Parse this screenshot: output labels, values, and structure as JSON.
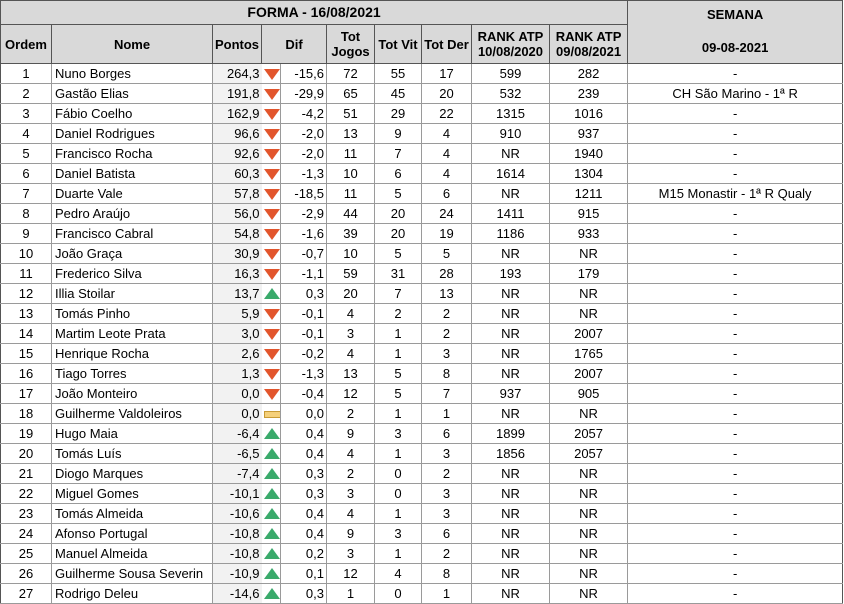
{
  "header": {
    "forma_title": "FORMA - 16/08/2021",
    "col_ordem": "Ordem",
    "col_nome": "Nome",
    "col_pontos": "Pontos",
    "col_dif": "Dif",
    "col_tot_jogos_1": "Tot",
    "col_tot_jogos_2": "Jogos",
    "col_tot_vit": "Tot Vit",
    "col_tot_der": "Tot Der",
    "rank_2020_1": "RANK ATP",
    "rank_2020_2": "10/08/2020",
    "rank_2021_1": "RANK ATP",
    "rank_2021_2": "09/08/2021",
    "semana_1": "SEMANA",
    "semana_2": "09-08-2021"
  },
  "colors": {
    "down": "#e2552c",
    "up": "#3aaa6b",
    "flat": "#f5d07a",
    "header_bg": "#d9d9d9"
  },
  "rows": [
    {
      "ordem": "1",
      "nome": "Nuno Borges",
      "pontos": "264,3",
      "trend": "down",
      "dif": "-15,6",
      "jogos": "72",
      "vit": "55",
      "der": "17",
      "r2020": "599",
      "r2021": "282",
      "semana": "-"
    },
    {
      "ordem": "2",
      "nome": "Gastão Elias",
      "pontos": "191,8",
      "trend": "down",
      "dif": "-29,9",
      "jogos": "65",
      "vit": "45",
      "der": "20",
      "r2020": "532",
      "r2021": "239",
      "semana": "CH São Marino - 1ª R"
    },
    {
      "ordem": "3",
      "nome": "Fábio Coelho",
      "pontos": "162,9",
      "trend": "down",
      "dif": "-4,2",
      "jogos": "51",
      "vit": "29",
      "der": "22",
      "r2020": "1315",
      "r2021": "1016",
      "semana": "-"
    },
    {
      "ordem": "4",
      "nome": "Daniel Rodrigues",
      "pontos": "96,6",
      "trend": "down",
      "dif": "-2,0",
      "jogos": "13",
      "vit": "9",
      "der": "4",
      "r2020": "910",
      "r2021": "937",
      "semana": "-"
    },
    {
      "ordem": "5",
      "nome": "Francisco Rocha",
      "pontos": "92,6",
      "trend": "down",
      "dif": "-2,0",
      "jogos": "11",
      "vit": "7",
      "der": "4",
      "r2020": "NR",
      "r2021": "1940",
      "semana": "-"
    },
    {
      "ordem": "6",
      "nome": "Daniel Batista",
      "pontos": "60,3",
      "trend": "down",
      "dif": "-1,3",
      "jogos": "10",
      "vit": "6",
      "der": "4",
      "r2020": "1614",
      "r2021": "1304",
      "semana": "-"
    },
    {
      "ordem": "7",
      "nome": "Duarte Vale",
      "pontos": "57,8",
      "trend": "down",
      "dif": "-18,5",
      "jogos": "11",
      "vit": "5",
      "der": "6",
      "r2020": "NR",
      "r2021": "1211",
      "semana": "M15 Monastir - 1ª R Qualy"
    },
    {
      "ordem": "8",
      "nome": "Pedro Araújo",
      "pontos": "56,0",
      "trend": "down",
      "dif": "-2,9",
      "jogos": "44",
      "vit": "20",
      "der": "24",
      "r2020": "1411",
      "r2021": "915",
      "semana": "-"
    },
    {
      "ordem": "9",
      "nome": "Francisco Cabral",
      "pontos": "54,8",
      "trend": "down",
      "dif": "-1,6",
      "jogos": "39",
      "vit": "20",
      "der": "19",
      "r2020": "1186",
      "r2021": "933",
      "semana": "-"
    },
    {
      "ordem": "10",
      "nome": "João Graça",
      "pontos": "30,9",
      "trend": "down",
      "dif": "-0,7",
      "jogos": "10",
      "vit": "5",
      "der": "5",
      "r2020": "NR",
      "r2021": "NR",
      "semana": "-"
    },
    {
      "ordem": "11",
      "nome": "Frederico Silva",
      "pontos": "16,3",
      "trend": "down",
      "dif": "-1,1",
      "jogos": "59",
      "vit": "31",
      "der": "28",
      "r2020": "193",
      "r2021": "179",
      "semana": "-"
    },
    {
      "ordem": "12",
      "nome": "Illia Stoilar",
      "pontos": "13,7",
      "trend": "up",
      "dif": "0,3",
      "jogos": "20",
      "vit": "7",
      "der": "13",
      "r2020": "NR",
      "r2021": "NR",
      "semana": "-"
    },
    {
      "ordem": "13",
      "nome": "Tomás Pinho",
      "pontos": "5,9",
      "trend": "down",
      "dif": "-0,1",
      "jogos": "4",
      "vit": "2",
      "der": "2",
      "r2020": "NR",
      "r2021": "NR",
      "semana": "-"
    },
    {
      "ordem": "14",
      "nome": "Martim Leote Prata",
      "pontos": "3,0",
      "trend": "down",
      "dif": "-0,1",
      "jogos": "3",
      "vit": "1",
      "der": "2",
      "r2020": "NR",
      "r2021": "2007",
      "semana": "-"
    },
    {
      "ordem": "15",
      "nome": "Henrique Rocha",
      "pontos": "2,6",
      "trend": "down",
      "dif": "-0,2",
      "jogos": "4",
      "vit": "1",
      "der": "3",
      "r2020": "NR",
      "r2021": "1765",
      "semana": "-"
    },
    {
      "ordem": "16",
      "nome": "Tiago Torres",
      "pontos": "1,3",
      "trend": "down",
      "dif": "-1,3",
      "jogos": "13",
      "vit": "5",
      "der": "8",
      "r2020": "NR",
      "r2021": "2007",
      "semana": "-"
    },
    {
      "ordem": "17",
      "nome": "João Monteiro",
      "pontos": "0,0",
      "trend": "down",
      "dif": "-0,4",
      "jogos": "12",
      "vit": "5",
      "der": "7",
      "r2020": "937",
      "r2021": "905",
      "semana": "-"
    },
    {
      "ordem": "18",
      "nome": "Guilherme Valdoleiros",
      "pontos": "0,0",
      "trend": "flat",
      "dif": "0,0",
      "jogos": "2",
      "vit": "1",
      "der": "1",
      "r2020": "NR",
      "r2021": "NR",
      "semana": "-"
    },
    {
      "ordem": "19",
      "nome": "Hugo Maia",
      "pontos": "-6,4",
      "trend": "up",
      "dif": "0,4",
      "jogos": "9",
      "vit": "3",
      "der": "6",
      "r2020": "1899",
      "r2021": "2057",
      "semana": "-"
    },
    {
      "ordem": "20",
      "nome": "Tomás Luís",
      "pontos": "-6,5",
      "trend": "up",
      "dif": "0,4",
      "jogos": "4",
      "vit": "1",
      "der": "3",
      "r2020": "1856",
      "r2021": "2057",
      "semana": "-"
    },
    {
      "ordem": "21",
      "nome": "Diogo Marques",
      "pontos": "-7,4",
      "trend": "up",
      "dif": "0,3",
      "jogos": "2",
      "vit": "0",
      "der": "2",
      "r2020": "NR",
      "r2021": "NR",
      "semana": "-"
    },
    {
      "ordem": "22",
      "nome": "Miguel Gomes",
      "pontos": "-10,1",
      "trend": "up",
      "dif": "0,3",
      "jogos": "3",
      "vit": "0",
      "der": "3",
      "r2020": "NR",
      "r2021": "NR",
      "semana": "-"
    },
    {
      "ordem": "23",
      "nome": "Tomás Almeida",
      "pontos": "-10,6",
      "trend": "up",
      "dif": "0,4",
      "jogos": "4",
      "vit": "1",
      "der": "3",
      "r2020": "NR",
      "r2021": "NR",
      "semana": "-"
    },
    {
      "ordem": "24",
      "nome": "Afonso Portugal",
      "pontos": "-10,8",
      "trend": "up",
      "dif": "0,4",
      "jogos": "9",
      "vit": "3",
      "der": "6",
      "r2020": "NR",
      "r2021": "NR",
      "semana": "-"
    },
    {
      "ordem": "25",
      "nome": "Manuel Almeida",
      "pontos": "-10,8",
      "trend": "up",
      "dif": "0,2",
      "jogos": "3",
      "vit": "1",
      "der": "2",
      "r2020": "NR",
      "r2021": "NR",
      "semana": "-"
    },
    {
      "ordem": "26",
      "nome": "Guilherme Sousa Severin",
      "pontos": "-10,9",
      "trend": "up",
      "dif": "0,1",
      "jogos": "12",
      "vit": "4",
      "der": "8",
      "r2020": "NR",
      "r2021": "NR",
      "semana": "-"
    },
    {
      "ordem": "27",
      "nome": "Rodrigo Deleu",
      "pontos": "-14,6",
      "trend": "up",
      "dif": "0,3",
      "jogos": "1",
      "vit": "0",
      "der": "1",
      "r2020": "NR",
      "r2021": "NR",
      "semana": "-"
    }
  ]
}
